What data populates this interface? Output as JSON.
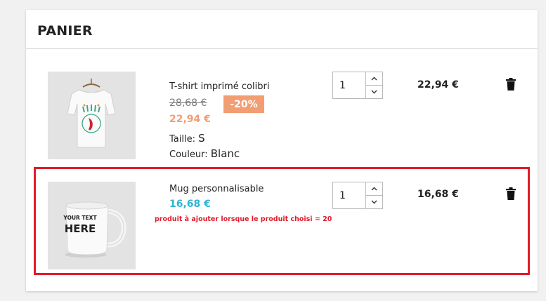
{
  "cart": {
    "title": "PANIER"
  },
  "items": [
    {
      "name": "T-shirt imprimé colibri",
      "old_price": "28,68 €",
      "discount": "-20%",
      "price": "22,94 €",
      "attributes": [
        {
          "label": "Taille:",
          "value": "S"
        },
        {
          "label": "Couleur:",
          "value": "Blanc"
        }
      ],
      "quantity": "1",
      "line_total": "22,94 €"
    },
    {
      "name": "Mug personnalisable",
      "price": "16,68 €",
      "note": "produit à ajouter lorsque le produit choisi = 20",
      "mug_text_1": "YOUR TEXT",
      "mug_text_2": "HERE",
      "quantity": "1",
      "line_total": "16,68 €"
    }
  ],
  "colors": {
    "discount": "#f39d72",
    "price_blue": "#2fb5d2",
    "highlight": "#e21b2b"
  },
  "icons": {
    "increment": "chevron-up-icon",
    "decrement": "chevron-down-icon",
    "remove": "trash-icon"
  }
}
